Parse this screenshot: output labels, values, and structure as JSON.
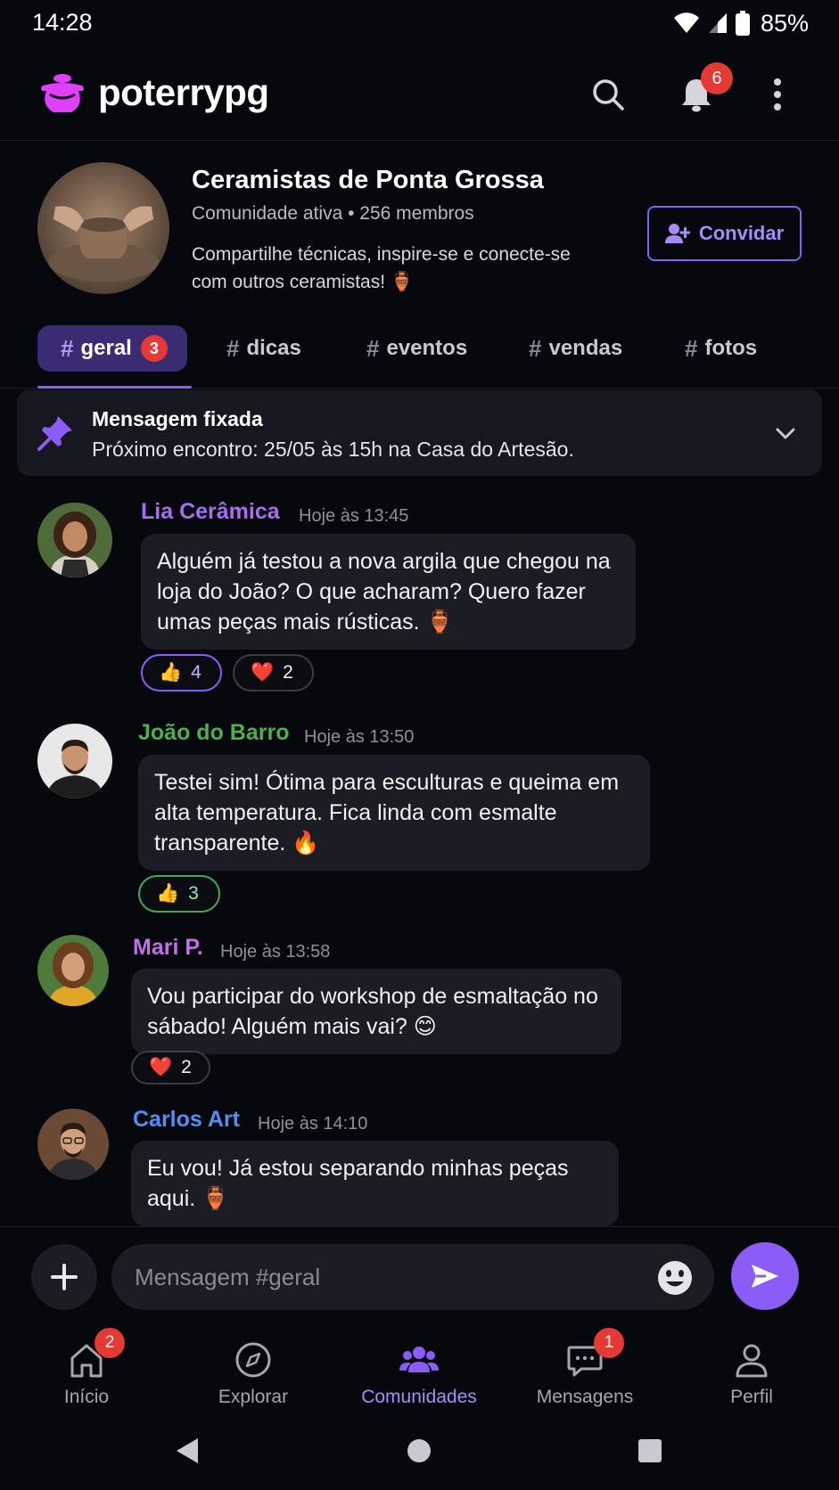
{
  "status_bar": {
    "time": "14:28",
    "battery": "85%"
  },
  "app_bar": {
    "brand": "poterrypg",
    "notification_count": "6"
  },
  "community": {
    "name": "Ceramistas de Ponta Grossa",
    "meta": "Comunidade ativa • 256 membros",
    "description": "Compartilhe técnicas, inspire-se e conecte-se com outros ceramistas! 🏺",
    "invite_label": "Convidar"
  },
  "channels": [
    {
      "name": "geral",
      "badge": "3"
    },
    {
      "name": "dicas"
    },
    {
      "name": "eventos"
    },
    {
      "name": "vendas"
    },
    {
      "name": "fotos"
    }
  ],
  "pinned": {
    "title": "Mensagem fixada",
    "text": "Próximo encontro: 25/05 às 15h na Casa do Artesão."
  },
  "messages": [
    {
      "author": "Lia Cerâmica",
      "author_color": "#a66df0",
      "time": "Hoje às 13:45",
      "text": "Alguém já testou a nova argila que chegou na loja do João? O que acharam? Quero fazer umas peças mais rústicas. 🏺",
      "reactions": [
        {
          "emoji": "👍",
          "count": "4"
        },
        {
          "emoji": "❤️",
          "count": "2"
        }
      ]
    },
    {
      "author": "João do Barro",
      "author_color": "#4caf50",
      "time": "Hoje às 13:50",
      "text": "Testei sim! Ótima para esculturas e queima em alta temperatura. Fica linda com esmalte transparente. 🔥",
      "reactions": [
        {
          "emoji": "👍",
          "count": "3"
        }
      ]
    },
    {
      "author": "Mari P.",
      "author_color": "#c46ee8",
      "time": "Hoje às 13:58",
      "text": "Vou participar do workshop de esmaltação no sábado! Alguém mais vai? 😊",
      "reactions": [
        {
          "emoji": "❤️",
          "count": "2"
        }
      ]
    },
    {
      "author": "Carlos Art",
      "author_color": "#4f8ff7",
      "time": "Hoje às 14:10",
      "text": "Eu vou! Já estou separando minhas peças aqui. 🏺"
    }
  ],
  "composer": {
    "placeholder": "Mensagem #geral"
  },
  "bottom_nav": [
    {
      "label": "Início",
      "badge": "2"
    },
    {
      "label": "Explorar"
    },
    {
      "label": "Comunidades"
    },
    {
      "label": "Mensagens",
      "badge": "1"
    },
    {
      "label": "Perfil"
    }
  ],
  "colors": {
    "accent": "#8b5cf6",
    "badge": "#e53935",
    "background": "#07080d",
    "brand_icon": "#e040fb"
  },
  "icons": [
    "pot-logo-icon",
    "search-icon",
    "bell-icon",
    "more-vert-icon",
    "add-person-icon",
    "pin-icon",
    "chevron-down-icon",
    "plus-icon",
    "emoji-icon",
    "send-icon",
    "home-icon",
    "compass-icon",
    "people-icon",
    "chat-icon",
    "person-icon"
  ]
}
